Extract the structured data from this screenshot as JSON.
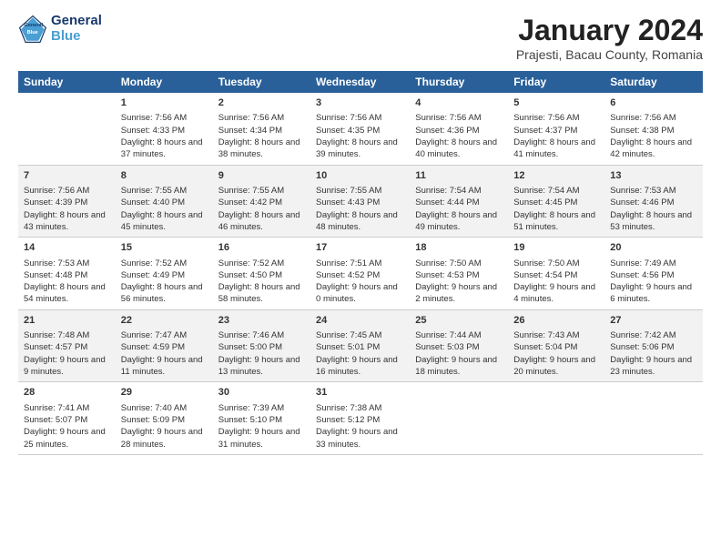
{
  "logo": {
    "line1": "General",
    "line2": "Blue"
  },
  "title": "January 2024",
  "subtitle": "Prajesti, Bacau County, Romania",
  "days_header": [
    "Sunday",
    "Monday",
    "Tuesday",
    "Wednesday",
    "Thursday",
    "Friday",
    "Saturday"
  ],
  "weeks": [
    [
      {
        "day": "",
        "rise": "",
        "set": "",
        "daylight": ""
      },
      {
        "day": "1",
        "rise": "Sunrise: 7:56 AM",
        "set": "Sunset: 4:33 PM",
        "daylight": "Daylight: 8 hours and 37 minutes."
      },
      {
        "day": "2",
        "rise": "Sunrise: 7:56 AM",
        "set": "Sunset: 4:34 PM",
        "daylight": "Daylight: 8 hours and 38 minutes."
      },
      {
        "day": "3",
        "rise": "Sunrise: 7:56 AM",
        "set": "Sunset: 4:35 PM",
        "daylight": "Daylight: 8 hours and 39 minutes."
      },
      {
        "day": "4",
        "rise": "Sunrise: 7:56 AM",
        "set": "Sunset: 4:36 PM",
        "daylight": "Daylight: 8 hours and 40 minutes."
      },
      {
        "day": "5",
        "rise": "Sunrise: 7:56 AM",
        "set": "Sunset: 4:37 PM",
        "daylight": "Daylight: 8 hours and 41 minutes."
      },
      {
        "day": "6",
        "rise": "Sunrise: 7:56 AM",
        "set": "Sunset: 4:38 PM",
        "daylight": "Daylight: 8 hours and 42 minutes."
      }
    ],
    [
      {
        "day": "7",
        "rise": "Sunrise: 7:56 AM",
        "set": "Sunset: 4:39 PM",
        "daylight": "Daylight: 8 hours and 43 minutes."
      },
      {
        "day": "8",
        "rise": "Sunrise: 7:55 AM",
        "set": "Sunset: 4:40 PM",
        "daylight": "Daylight: 8 hours and 45 minutes."
      },
      {
        "day": "9",
        "rise": "Sunrise: 7:55 AM",
        "set": "Sunset: 4:42 PM",
        "daylight": "Daylight: 8 hours and 46 minutes."
      },
      {
        "day": "10",
        "rise": "Sunrise: 7:55 AM",
        "set": "Sunset: 4:43 PM",
        "daylight": "Daylight: 8 hours and 48 minutes."
      },
      {
        "day": "11",
        "rise": "Sunrise: 7:54 AM",
        "set": "Sunset: 4:44 PM",
        "daylight": "Daylight: 8 hours and 49 minutes."
      },
      {
        "day": "12",
        "rise": "Sunrise: 7:54 AM",
        "set": "Sunset: 4:45 PM",
        "daylight": "Daylight: 8 hours and 51 minutes."
      },
      {
        "day": "13",
        "rise": "Sunrise: 7:53 AM",
        "set": "Sunset: 4:46 PM",
        "daylight": "Daylight: 8 hours and 53 minutes."
      }
    ],
    [
      {
        "day": "14",
        "rise": "Sunrise: 7:53 AM",
        "set": "Sunset: 4:48 PM",
        "daylight": "Daylight: 8 hours and 54 minutes."
      },
      {
        "day": "15",
        "rise": "Sunrise: 7:52 AM",
        "set": "Sunset: 4:49 PM",
        "daylight": "Daylight: 8 hours and 56 minutes."
      },
      {
        "day": "16",
        "rise": "Sunrise: 7:52 AM",
        "set": "Sunset: 4:50 PM",
        "daylight": "Daylight: 8 hours and 58 minutes."
      },
      {
        "day": "17",
        "rise": "Sunrise: 7:51 AM",
        "set": "Sunset: 4:52 PM",
        "daylight": "Daylight: 9 hours and 0 minutes."
      },
      {
        "day": "18",
        "rise": "Sunrise: 7:50 AM",
        "set": "Sunset: 4:53 PM",
        "daylight": "Daylight: 9 hours and 2 minutes."
      },
      {
        "day": "19",
        "rise": "Sunrise: 7:50 AM",
        "set": "Sunset: 4:54 PM",
        "daylight": "Daylight: 9 hours and 4 minutes."
      },
      {
        "day": "20",
        "rise": "Sunrise: 7:49 AM",
        "set": "Sunset: 4:56 PM",
        "daylight": "Daylight: 9 hours and 6 minutes."
      }
    ],
    [
      {
        "day": "21",
        "rise": "Sunrise: 7:48 AM",
        "set": "Sunset: 4:57 PM",
        "daylight": "Daylight: 9 hours and 9 minutes."
      },
      {
        "day": "22",
        "rise": "Sunrise: 7:47 AM",
        "set": "Sunset: 4:59 PM",
        "daylight": "Daylight: 9 hours and 11 minutes."
      },
      {
        "day": "23",
        "rise": "Sunrise: 7:46 AM",
        "set": "Sunset: 5:00 PM",
        "daylight": "Daylight: 9 hours and 13 minutes."
      },
      {
        "day": "24",
        "rise": "Sunrise: 7:45 AM",
        "set": "Sunset: 5:01 PM",
        "daylight": "Daylight: 9 hours and 16 minutes."
      },
      {
        "day": "25",
        "rise": "Sunrise: 7:44 AM",
        "set": "Sunset: 5:03 PM",
        "daylight": "Daylight: 9 hours and 18 minutes."
      },
      {
        "day": "26",
        "rise": "Sunrise: 7:43 AM",
        "set": "Sunset: 5:04 PM",
        "daylight": "Daylight: 9 hours and 20 minutes."
      },
      {
        "day": "27",
        "rise": "Sunrise: 7:42 AM",
        "set": "Sunset: 5:06 PM",
        "daylight": "Daylight: 9 hours and 23 minutes."
      }
    ],
    [
      {
        "day": "28",
        "rise": "Sunrise: 7:41 AM",
        "set": "Sunset: 5:07 PM",
        "daylight": "Daylight: 9 hours and 25 minutes."
      },
      {
        "day": "29",
        "rise": "Sunrise: 7:40 AM",
        "set": "Sunset: 5:09 PM",
        "daylight": "Daylight: 9 hours and 28 minutes."
      },
      {
        "day": "30",
        "rise": "Sunrise: 7:39 AM",
        "set": "Sunset: 5:10 PM",
        "daylight": "Daylight: 9 hours and 31 minutes."
      },
      {
        "day": "31",
        "rise": "Sunrise: 7:38 AM",
        "set": "Sunset: 5:12 PM",
        "daylight": "Daylight: 9 hours and 33 minutes."
      },
      {
        "day": "",
        "rise": "",
        "set": "",
        "daylight": ""
      },
      {
        "day": "",
        "rise": "",
        "set": "",
        "daylight": ""
      },
      {
        "day": "",
        "rise": "",
        "set": "",
        "daylight": ""
      }
    ]
  ]
}
